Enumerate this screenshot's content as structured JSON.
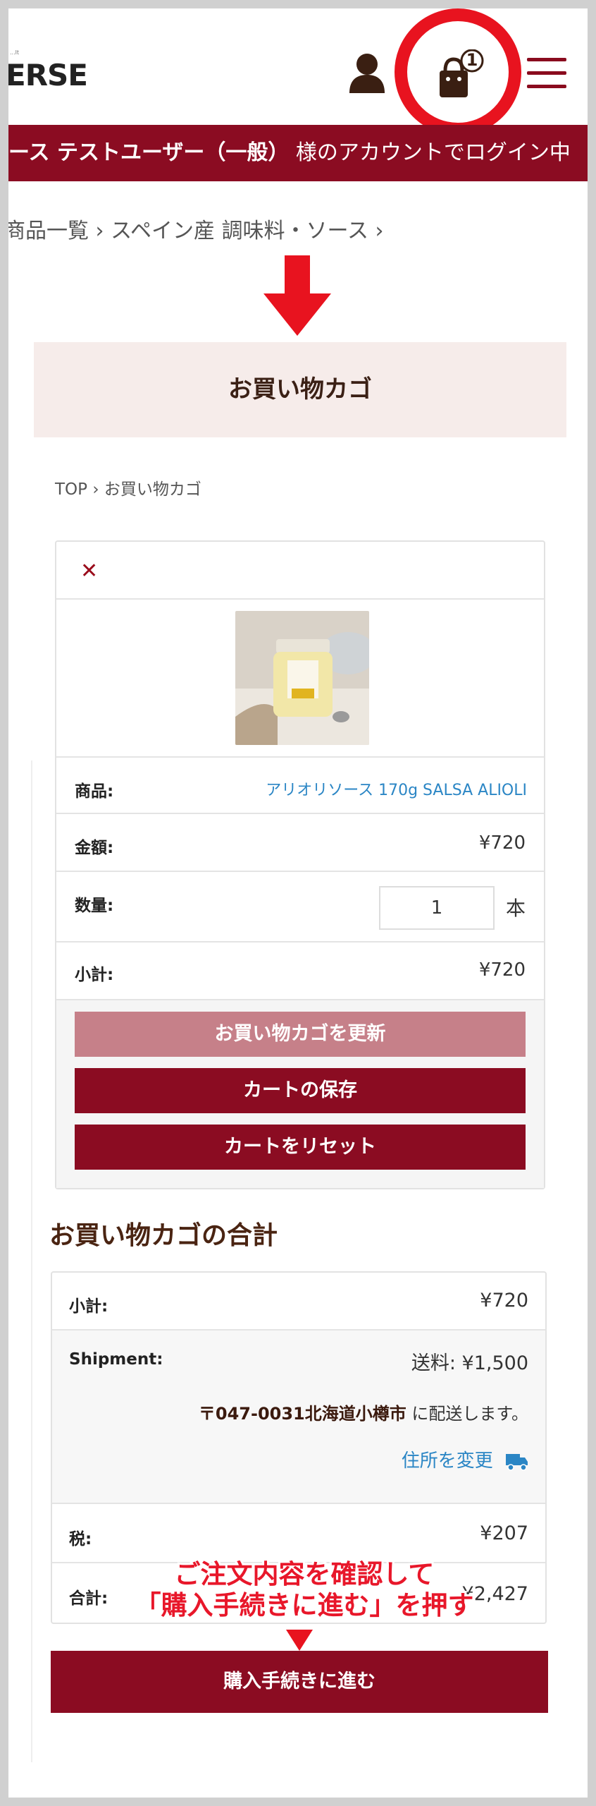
{
  "header": {
    "logo_text": "ERSE",
    "logo_sup": "...lt",
    "user_icon": "user-icon",
    "cart_icon": "cart-bag-icon",
    "cart_count": "1",
    "menu_icon": "hamburger-menu-icon"
  },
  "banner": {
    "text": "ース テストユーザー（一般）",
    "suffix": " 様のアカウントでログイン中"
  },
  "breadcrumb_top": "商品一覧 › スペイン産 調味料・ソース ›",
  "page_title": "お買い物カゴ",
  "breadcrumb": "TOP › お買い物カゴ",
  "cart": {
    "remove_icon": "close-icon",
    "product_label": "商品:",
    "product_name": "アリオリソース 170g SALSA ALIOLI",
    "price_label": "金額:",
    "price_value": "¥720",
    "qty_label": "数量:",
    "qty_value": "1",
    "qty_unit": "本",
    "subtotal_label": "小計:",
    "subtotal_value": "¥720",
    "btn_update": "お買い物カゴを更新",
    "btn_save": "カートの保存",
    "btn_reset": "カートをリセット"
  },
  "totals": {
    "title": "お買い物カゴの合計",
    "subtotal_label": "小計:",
    "subtotal_value": "¥720",
    "shipment_label": "Shipment:",
    "shipment_value": "送料: ¥1,500",
    "ship_address": "〒047-0031北海道小樽市",
    "ship_address_suffix": " に配送します。",
    "change_address": "住所を変更",
    "change_icon": "truck-icon",
    "tax_label": "税:",
    "tax_value": "¥207",
    "total_label": "合計:",
    "total_value": "¥2,427"
  },
  "annotation": {
    "line1": "ご注文内容を確認して",
    "line2": "「購入手続きに進む」を押す"
  },
  "checkout_button": "購入手続きに進む",
  "colors": {
    "brand": "#8b0c22",
    "highlight": "#e8131f",
    "link": "#2b86c5"
  }
}
